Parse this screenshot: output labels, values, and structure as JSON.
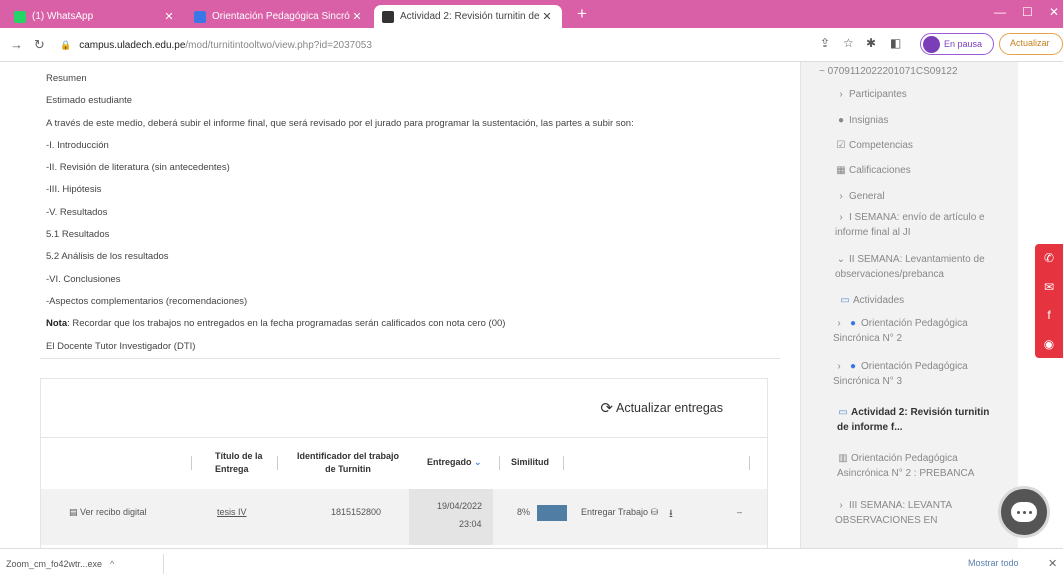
{
  "browser": {
    "tabs": [
      {
        "title": "(1) WhatsApp",
        "active": false,
        "favicon_color": "#25d366"
      },
      {
        "title": "Orientación Pedagógica Sincrón...",
        "active": false,
        "favicon_color": "#3b78e7"
      },
      {
        "title": "Actividad 2: Revisión turnitin de...",
        "active": true,
        "favicon_color": "#333333"
      }
    ],
    "new_tab": "+",
    "url_host": "campus.uladech.edu.pe",
    "url_path": "/mod/turnitintooltwo/view.php?id=2037053",
    "profile_label": "En pausa",
    "update_label": "Actualizar"
  },
  "assignment": {
    "lines": [
      "Resumen",
      "Estimado estudiante",
      "A través de este medio, deberá subir el informe final, que será revisado por el jurado para programar la sustentación, las partes a subir son:",
      "-I. Introducción",
      "-II. Revisión de literatura (sin antecedentes)",
      "-III. Hipótesis",
      "-V. Resultados",
      "5.1 Resultados",
      "5.2 Análisis de los resultados",
      "-VI. Conclusiones",
      "-Aspectos complementarios (recomendaciones)"
    ],
    "note_label": "Nota",
    "note_text": ": Recordar que los trabajos no entregados en la fecha programadas serán calificados con nota cero (00)",
    "signature": "El Docente Tutor Investigador (DTI)"
  },
  "submissions": {
    "refresh_label": "Actualizar entregas",
    "columns": {
      "title": "Título de la Entrega",
      "paper_id": "Identificador del trabajo de Turnitin",
      "submitted": "Entregado",
      "similarity": "Similitud"
    },
    "row": {
      "receipt": "Ver recibo digital",
      "title": "tesis IV",
      "paper_id": "1815152800",
      "date": "19/04/2022",
      "time": "23:04",
      "similarity": "8%",
      "submit_label": "Entregar Trabajo"
    }
  },
  "sidebar": {
    "course_code": "~ 0709112022201071CS09122",
    "items": [
      "Participantes",
      "Insignias",
      "Competencias",
      "Calificaciones",
      "General",
      "I SEMANA: envío de artículo e informe final al JI",
      "II SEMANA: Levantamiento de observaciones/prebanca",
      "Actividades",
      "Orientación Pedagógica Sincrónica N° 2",
      "Orientación Pedagógica Sincrónica N° 3",
      "Actividad 2: Revisión turnitin de informe f...",
      "Orientación Pedagógica Asincrónica N° 2 : PREBANCA",
      "III SEMANA: LEVANTA OBSERVACIONES EN"
    ]
  },
  "downloads": {
    "file": "Zoom_cm_fo42wtr...exe",
    "show_all": "Mostrar todo"
  },
  "colors": {
    "tabstrip": "#d960a6",
    "accent_red": "#e53340",
    "similarity_bar": "#4f7da3"
  }
}
